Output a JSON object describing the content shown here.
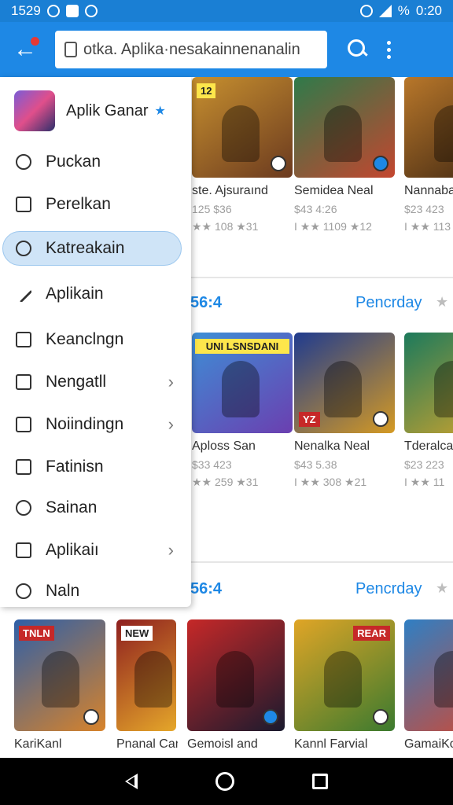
{
  "status_bar": {
    "time_left": "1529",
    "time_right": "0:20",
    "battery": "%"
  },
  "app_bar": {
    "url": "otka. Aplika·nesakainnenanalin"
  },
  "drawer": {
    "title": "Aplik Ganar",
    "items": [
      {
        "label": "Puckan",
        "icon": "target-icon",
        "chevron": false
      },
      {
        "label": "Perelkan",
        "icon": "square-icon",
        "chevron": false
      },
      {
        "label": "Katreakain",
        "icon": "bell-icon",
        "chevron": false,
        "active": true
      },
      {
        "label": "Aplikain",
        "icon": "pencil-icon",
        "chevron": false
      },
      {
        "label": "Keanclngn",
        "icon": "square-icon",
        "chevron": false
      },
      {
        "label": "Nengatll",
        "icon": "calendar-icon",
        "chevron": true
      },
      {
        "label": "Noiindingn",
        "icon": "square-icon",
        "chevron": true
      },
      {
        "label": "Fatinisn",
        "icon": "file-icon",
        "chevron": false
      },
      {
        "label": "Sainan",
        "icon": "radio-icon",
        "chevron": false
      },
      {
        "label": "Aplikaiı",
        "icon": "square-icon",
        "chevron": true
      },
      {
        "label": "Naln",
        "icon": "compass-icon",
        "chevron": false
      }
    ]
  },
  "sections": [
    {
      "heading_left": "",
      "heading_right": "",
      "cards": [
        {
          "tag": "12",
          "title": "ste. Ajsuraınd",
          "price": "125  $36",
          "stats": "★★ 108   ★31",
          "color1": "#c7902f",
          "color2": "#6b3a1f"
        },
        {
          "tag": "",
          "title": "Semidea Neal",
          "price": "$43  4:26",
          "stats": "I ★★ 1109   ★12",
          "color1": "#2f7a4a",
          "color2": "#c4462f"
        },
        {
          "tag": "",
          "title": "Nannaba",
          "price": "$23  423",
          "stats": "I ★★ 113",
          "color1": "#b8772a",
          "color2": "#3e2612"
        }
      ]
    },
    {
      "heading_left": "56:4",
      "heading_right": "Pencrday",
      "cards": [
        {
          "tag": "UNI LSNSDANI",
          "title": "Aploss San",
          "price": "$33  423",
          "stats": "★★ 259   ★31",
          "color1": "#3d8fd6",
          "color2": "#6b3fb0"
        },
        {
          "tag": "YZ",
          "title": "Nenalka Neal",
          "price": "$43  5.38",
          "stats": "I ★★ 308   ★21",
          "color1": "#1f3b8f",
          "color2": "#d59a23"
        },
        {
          "tag": "",
          "title": "Tderalca",
          "price": "$23  223",
          "stats": "I ★★ 11",
          "color1": "#1c7a5c",
          "color2": "#d6a52b"
        }
      ]
    },
    {
      "heading_left": "56:4",
      "heading_right": "Pencrday",
      "cards": [
        {
          "tag": "TNLN",
          "title": "KariKanl",
          "color1": "#2e5fa8",
          "color2": "#d8832a"
        },
        {
          "tag": "NEW",
          "title": "Pnanal Canl",
          "color1": "#8e1f1f",
          "color2": "#e5a72a"
        },
        {
          "tag": "",
          "title": "Gemoisl and",
          "color1": "#c62828",
          "color2": "#1a1a2e"
        },
        {
          "tag": "REAR",
          "title": "Kannl Farvial",
          "color1": "#e0a526",
          "color2": "#3b7a2f"
        },
        {
          "tag": "",
          "title": "GamaiKo",
          "color1": "#2f7fc4",
          "color2": "#d5472f"
        }
      ]
    }
  ]
}
